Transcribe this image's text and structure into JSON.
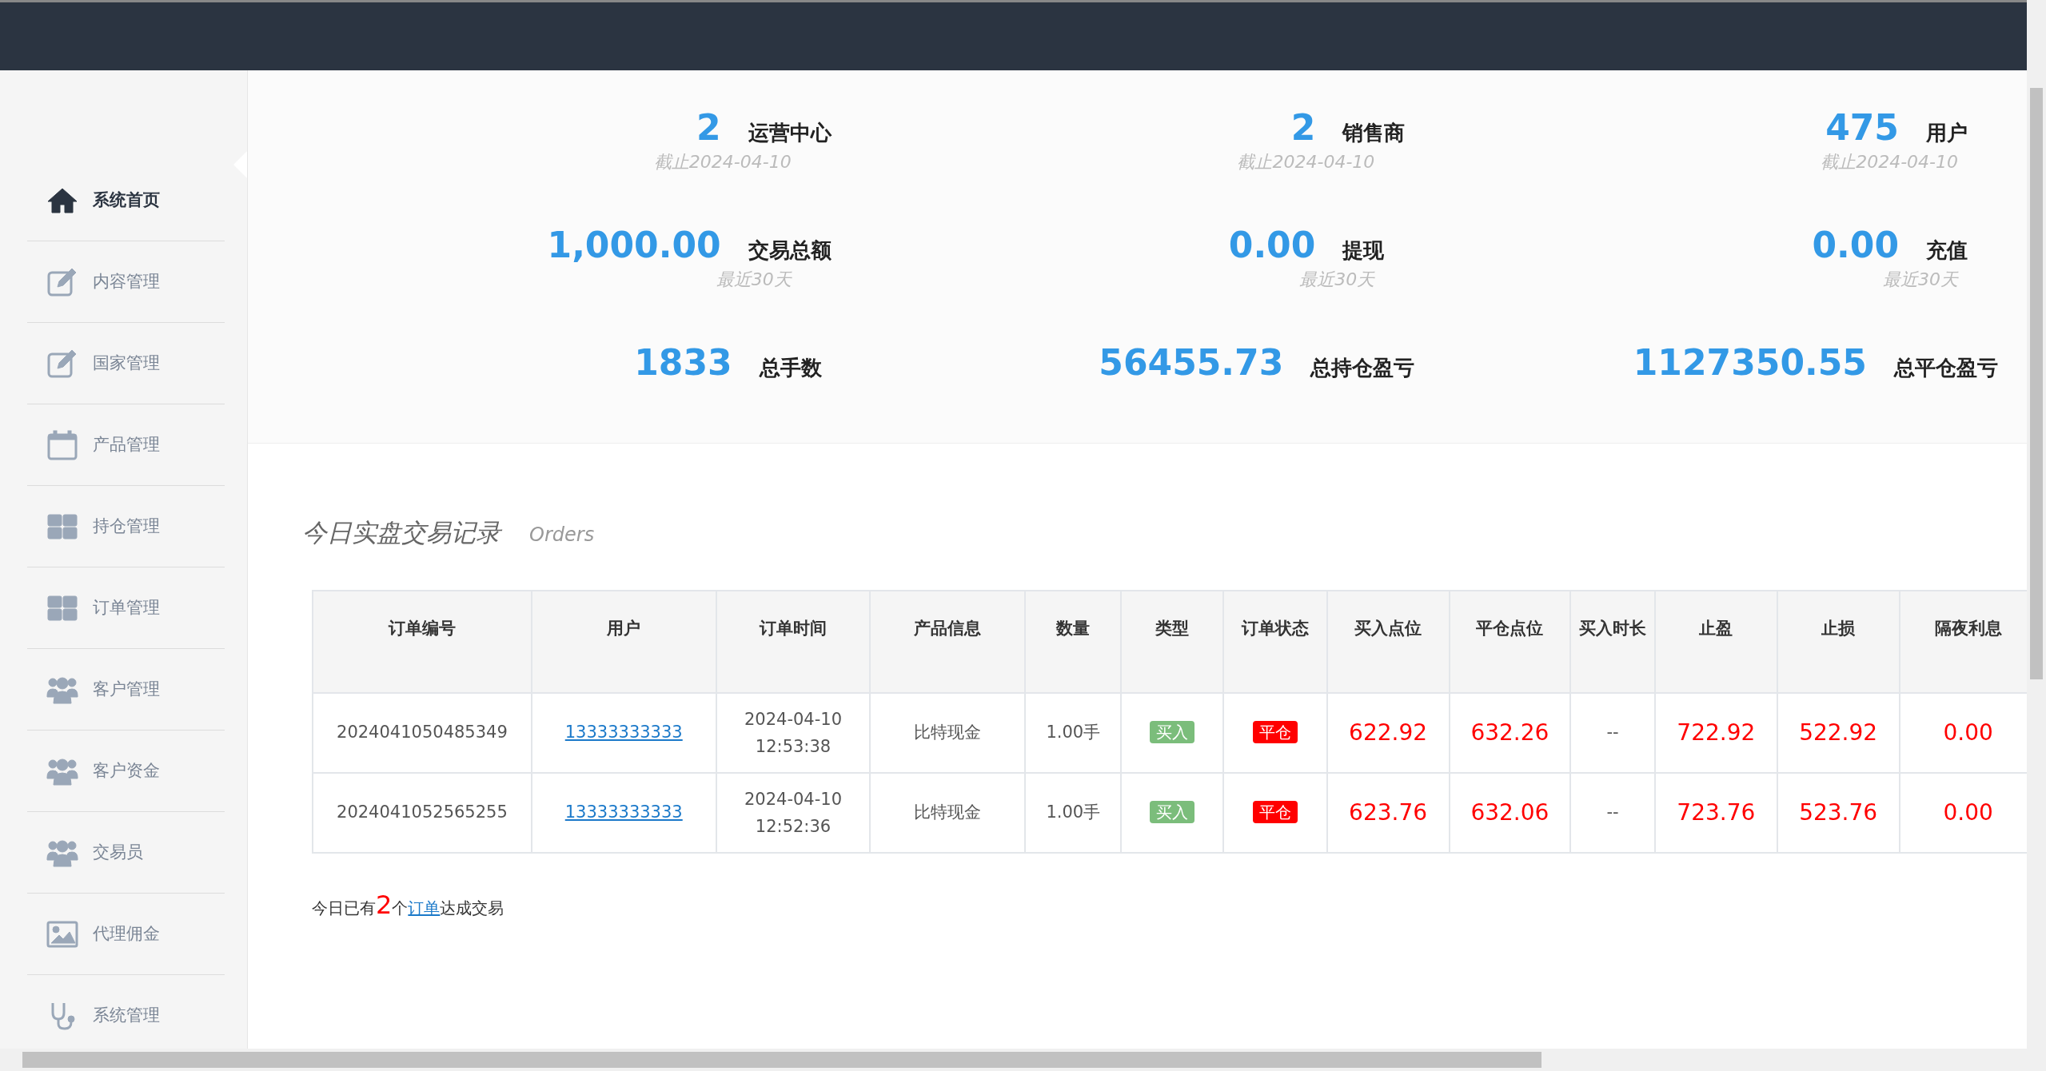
{
  "sidebar": {
    "items": [
      {
        "label": "系统首页",
        "selected": true
      },
      {
        "label": "内容管理",
        "selected": false
      },
      {
        "label": "国家管理",
        "selected": false
      },
      {
        "label": "产品管理",
        "selected": false
      },
      {
        "label": "持仓管理",
        "selected": false
      },
      {
        "label": "订单管理",
        "selected": false
      },
      {
        "label": "客户管理",
        "selected": false
      },
      {
        "label": "客户资金",
        "selected": false
      },
      {
        "label": "交易员",
        "selected": false
      },
      {
        "label": "代理佣金",
        "selected": false
      },
      {
        "label": "系统管理",
        "selected": false
      }
    ]
  },
  "stats": [
    {
      "value": "2",
      "label": "运营中心",
      "note": "截止2024-04-10"
    },
    {
      "value": "2",
      "label": "销售商",
      "note": "截止2024-04-10"
    },
    {
      "value": "475",
      "label": "用户",
      "note": "截止2024-04-10"
    },
    {
      "value": "1,000.00",
      "label": "交易总额",
      "note": "最近30天"
    },
    {
      "value": "0.00",
      "label": "提现",
      "note": "最近30天"
    },
    {
      "value": "0.00",
      "label": "充值",
      "note": "最近30天"
    },
    {
      "value": "1833",
      "label": "总手数"
    },
    {
      "value": "56455.73",
      "label": "总持仓盈亏"
    },
    {
      "value": "1127350.55",
      "label": "总平仓盈亏"
    }
  ],
  "orders": {
    "title": "今日实盘交易记录",
    "subtitle": "Orders",
    "columns": [
      "订单编号",
      "用户",
      "订单时间",
      "产品信息",
      "数量",
      "类型",
      "订单状态",
      "买入点位",
      "平仓点位",
      "买入时长",
      "止盈",
      "止损",
      "隔夜利息"
    ],
    "rows": [
      {
        "id": "2024041050485349",
        "user": "13333333333",
        "date": "2024-04-10",
        "time": "12:53:38",
        "product": "比特现金",
        "qty": "1.00手",
        "type": "买入",
        "status": "平仓",
        "open": "622.92",
        "close": "632.26",
        "duration": "--",
        "tp": "722.92",
        "sl": "522.92",
        "interest": "0.00"
      },
      {
        "id": "2024041052565255",
        "user": "13333333333",
        "date": "2024-04-10",
        "time": "12:52:36",
        "product": "比特现金",
        "qty": "1.00手",
        "type": "买入",
        "status": "平仓",
        "open": "623.76",
        "close": "632.06",
        "duration": "--",
        "tp": "723.76",
        "sl": "523.76",
        "interest": "0.00"
      }
    ],
    "summary": {
      "before": "今日已有",
      "count": "2",
      "middle": "个",
      "link": "订单",
      "after": "达成交易"
    }
  }
}
